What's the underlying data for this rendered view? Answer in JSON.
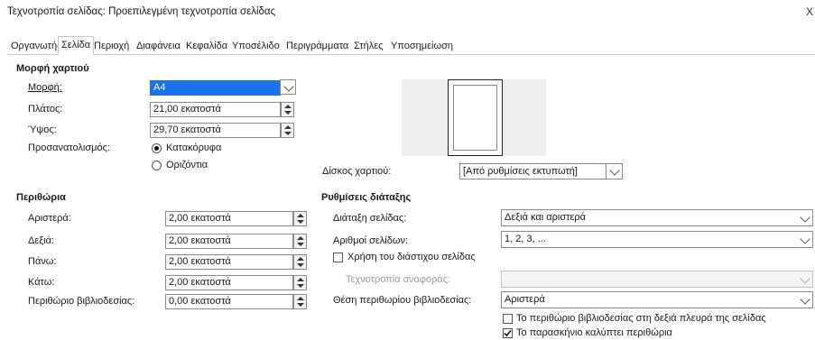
{
  "window": {
    "title": "Τεχνοτροπία σελίδας: Προεπιλεγμένη τεχνοτροπία σελίδας",
    "close_glyph": "X"
  },
  "tabs": [
    {
      "label": "Οργανωτής"
    },
    {
      "label": "Σελίδα"
    },
    {
      "label": "Περιοχή"
    },
    {
      "label": "Διαφάνεια"
    },
    {
      "label": "Κεφαλίδα"
    },
    {
      "label": "Υποσέλιδο"
    },
    {
      "label": "Περιγράμματα"
    },
    {
      "label": "Στήλες"
    },
    {
      "label": "Υποσημείωση"
    }
  ],
  "active_tab": "Σελίδα",
  "paper": {
    "heading": "Μορφή χαρτιού",
    "format_label": "Μορφή:",
    "format_value": "A4",
    "width_label": "Πλάτος:",
    "width_value": "21,00 εκατοστά",
    "height_label": "Ύψος:",
    "height_value": "29,70 εκατοστά",
    "orientation_label": "Προσανατολισμός:",
    "portrait_label": "Κατακόρυφα",
    "landscape_label": "Οριζόντια",
    "orientation_selected": "portrait",
    "tray_label": "Δίσκος χαρτιού:",
    "tray_value": "[Από ρυθμίσεις εκτυπωτή]"
  },
  "margins": {
    "heading": "Περιθώρια",
    "left_label": "Αριστερά:",
    "left_value": "2,00 εκατοστά",
    "right_label": "Δεξιά:",
    "right_value": "2,00 εκατοστά",
    "top_label": "Πάνω:",
    "top_value": "2,00 εκατοστά",
    "bottom_label": "Κάτω:",
    "bottom_value": "2,00 εκατοστά",
    "gutter_label": "Περιθώριο βιβλιοδεσίας:",
    "gutter_value": "0,00 εκατοστά"
  },
  "layout": {
    "heading": "Ρυθμίσεις διάταξης",
    "page_layout_label": "Διάταξη σελίδας:",
    "page_layout_value": "Δεξιά και αριστερά",
    "page_numbers_label": "Αριθμοί σελίδων:",
    "page_numbers_value": "1, 2, 3, ...",
    "register_true_label": "Χρήση του διάστιχου σελίδας",
    "register_true_checked": false,
    "reference_style_label": "Τεχνοτροπία αναφοράς:",
    "reference_style_value": "",
    "gutter_position_label": "Θέση περιθωρίου βιβλιοδεσίας:",
    "gutter_position_value": "Αριστερά",
    "gutter_right_label": "Το περιθώριο βιβλιοδεσίας στη δεξιά πλευρά της σελίδας",
    "gutter_right_checked": false,
    "background_covers_label": "Το παρασκήνιο καλύπτει περιθώρια",
    "background_covers_checked": true
  },
  "colors": {
    "selection": "#1a73e8",
    "preview_bg": "#eeeeee"
  }
}
